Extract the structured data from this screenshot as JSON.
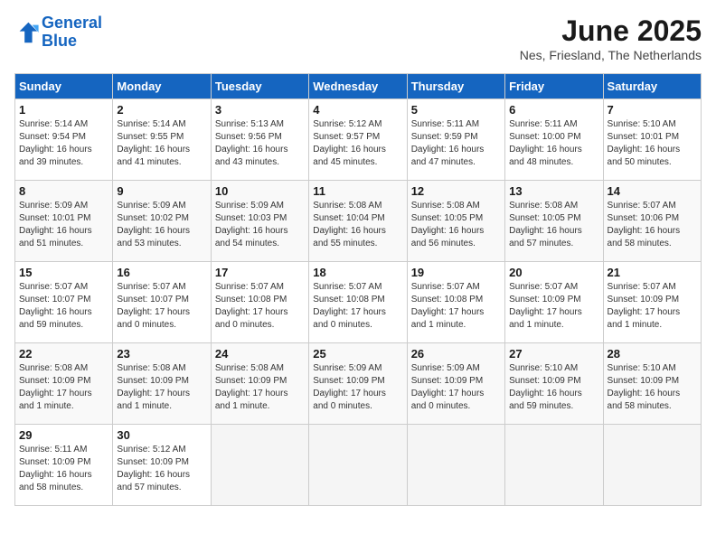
{
  "header": {
    "logo_line1": "General",
    "logo_line2": "Blue",
    "month": "June 2025",
    "location": "Nes, Friesland, The Netherlands"
  },
  "weekdays": [
    "Sunday",
    "Monday",
    "Tuesday",
    "Wednesday",
    "Thursday",
    "Friday",
    "Saturday"
  ],
  "weeks": [
    [
      {
        "day": "1",
        "rise": "5:14 AM",
        "set": "9:54 PM",
        "daylight": "16 hours and 39 minutes."
      },
      {
        "day": "2",
        "rise": "5:14 AM",
        "set": "9:55 PM",
        "daylight": "16 hours and 41 minutes."
      },
      {
        "day": "3",
        "rise": "5:13 AM",
        "set": "9:56 PM",
        "daylight": "16 hours and 43 minutes."
      },
      {
        "day": "4",
        "rise": "5:12 AM",
        "set": "9:57 PM",
        "daylight": "16 hours and 45 minutes."
      },
      {
        "day": "5",
        "rise": "5:11 AM",
        "set": "9:59 PM",
        "daylight": "16 hours and 47 minutes."
      },
      {
        "day": "6",
        "rise": "5:11 AM",
        "set": "10:00 PM",
        "daylight": "16 hours and 48 minutes."
      },
      {
        "day": "7",
        "rise": "5:10 AM",
        "set": "10:01 PM",
        "daylight": "16 hours and 50 minutes."
      }
    ],
    [
      {
        "day": "8",
        "rise": "5:09 AM",
        "set": "10:01 PM",
        "daylight": "16 hours and 51 minutes."
      },
      {
        "day": "9",
        "rise": "5:09 AM",
        "set": "10:02 PM",
        "daylight": "16 hours and 53 minutes."
      },
      {
        "day": "10",
        "rise": "5:09 AM",
        "set": "10:03 PM",
        "daylight": "16 hours and 54 minutes."
      },
      {
        "day": "11",
        "rise": "5:08 AM",
        "set": "10:04 PM",
        "daylight": "16 hours and 55 minutes."
      },
      {
        "day": "12",
        "rise": "5:08 AM",
        "set": "10:05 PM",
        "daylight": "16 hours and 56 minutes."
      },
      {
        "day": "13",
        "rise": "5:08 AM",
        "set": "10:05 PM",
        "daylight": "16 hours and 57 minutes."
      },
      {
        "day": "14",
        "rise": "5:07 AM",
        "set": "10:06 PM",
        "daylight": "16 hours and 58 minutes."
      }
    ],
    [
      {
        "day": "15",
        "rise": "5:07 AM",
        "set": "10:07 PM",
        "daylight": "16 hours and 59 minutes."
      },
      {
        "day": "16",
        "rise": "5:07 AM",
        "set": "10:07 PM",
        "daylight": "17 hours and 0 minutes."
      },
      {
        "day": "17",
        "rise": "5:07 AM",
        "set": "10:08 PM",
        "daylight": "17 hours and 0 minutes."
      },
      {
        "day": "18",
        "rise": "5:07 AM",
        "set": "10:08 PM",
        "daylight": "17 hours and 0 minutes."
      },
      {
        "day": "19",
        "rise": "5:07 AM",
        "set": "10:08 PM",
        "daylight": "17 hours and 1 minute."
      },
      {
        "day": "20",
        "rise": "5:07 AM",
        "set": "10:09 PM",
        "daylight": "17 hours and 1 minute."
      },
      {
        "day": "21",
        "rise": "5:07 AM",
        "set": "10:09 PM",
        "daylight": "17 hours and 1 minute."
      }
    ],
    [
      {
        "day": "22",
        "rise": "5:08 AM",
        "set": "10:09 PM",
        "daylight": "17 hours and 1 minute."
      },
      {
        "day": "23",
        "rise": "5:08 AM",
        "set": "10:09 PM",
        "daylight": "17 hours and 1 minute."
      },
      {
        "day": "24",
        "rise": "5:08 AM",
        "set": "10:09 PM",
        "daylight": "17 hours and 1 minute."
      },
      {
        "day": "25",
        "rise": "5:09 AM",
        "set": "10:09 PM",
        "daylight": "17 hours and 0 minutes."
      },
      {
        "day": "26",
        "rise": "5:09 AM",
        "set": "10:09 PM",
        "daylight": "17 hours and 0 minutes."
      },
      {
        "day": "27",
        "rise": "5:10 AM",
        "set": "10:09 PM",
        "daylight": "16 hours and 59 minutes."
      },
      {
        "day": "28",
        "rise": "5:10 AM",
        "set": "10:09 PM",
        "daylight": "16 hours and 58 minutes."
      }
    ],
    [
      {
        "day": "29",
        "rise": "5:11 AM",
        "set": "10:09 PM",
        "daylight": "16 hours and 58 minutes."
      },
      {
        "day": "30",
        "rise": "5:12 AM",
        "set": "10:09 PM",
        "daylight": "16 hours and 57 minutes."
      },
      null,
      null,
      null,
      null,
      null
    ]
  ],
  "labels": {
    "sunrise": "Sunrise:",
    "sunset": "Sunset:",
    "daylight": "Daylight:"
  }
}
